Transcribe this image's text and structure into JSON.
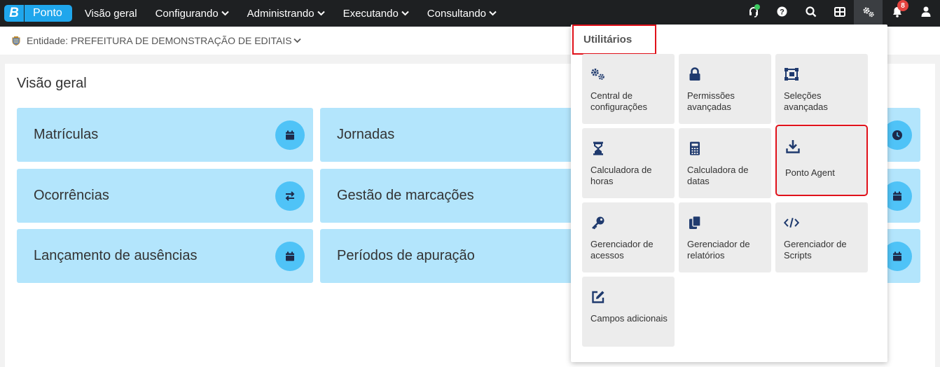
{
  "app": {
    "logo_letter": "B",
    "logo_name": "Ponto"
  },
  "nav": {
    "items": [
      {
        "label": "Visão geral",
        "has_menu": false
      },
      {
        "label": "Configurando",
        "has_menu": true
      },
      {
        "label": "Administrando",
        "has_menu": true
      },
      {
        "label": "Executando",
        "has_menu": true
      },
      {
        "label": "Consultando",
        "has_menu": true
      }
    ]
  },
  "topbar_icons": {
    "support": "headset-icon",
    "help": "question-icon",
    "search": "search-icon",
    "apps": "grid-icon",
    "utilities": "gears-icon",
    "notifications": "bell-icon",
    "notification_count": "8",
    "user": "user-icon"
  },
  "entity": {
    "label": "Entidade: PREFEITURA DE DEMONSTRAÇÃO DE EDITAIS"
  },
  "main": {
    "title": "Visão geral",
    "cards": [
      {
        "label": "Matrículas",
        "icon": "calendar-icon"
      },
      {
        "label": "Jornadas",
        "icon": "calendar-icon"
      },
      {
        "label": "Ocorrências",
        "icon": "swap-icon"
      },
      {
        "label": "Gestão de marcações",
        "icon": "calendar-icon"
      },
      {
        "label": "Lançamento de ausências",
        "icon": "calendar-icon"
      },
      {
        "label": "Períodos de apuração",
        "icon": "calendar-icon"
      }
    ],
    "right_icons": [
      "clock-icon",
      "calendar-icon",
      "calendar-icon"
    ]
  },
  "utilities": {
    "title": "Utilitários",
    "tiles": [
      {
        "label": "Central de configurações",
        "icon": "gears-icon"
      },
      {
        "label": "Permissões avançadas",
        "icon": "lock-icon"
      },
      {
        "label": "Seleções avançadas",
        "icon": "selection-icon"
      },
      {
        "label": "Calculadora de horas",
        "icon": "hourglass-icon"
      },
      {
        "label": "Calculadora de datas",
        "icon": "calculator-icon"
      },
      {
        "label": "Ponto Agent",
        "icon": "download-icon"
      },
      {
        "label": "Gerenciador de acessos",
        "icon": "key-icon"
      },
      {
        "label": "Gerenciador de relatórios",
        "icon": "copy-icon"
      },
      {
        "label": "Gerenciador de Scripts",
        "icon": "code-icon"
      },
      {
        "label": "Campos adicionais",
        "icon": "edit-icon"
      }
    ]
  },
  "colors": {
    "topbar": "#1e2022",
    "brand": "#1fa6ec",
    "card_bg": "#b3e5fc",
    "card_icon_bg": "#4fc3f7",
    "tile_icon": "#1f3a6e",
    "highlight": "#e0111a"
  }
}
